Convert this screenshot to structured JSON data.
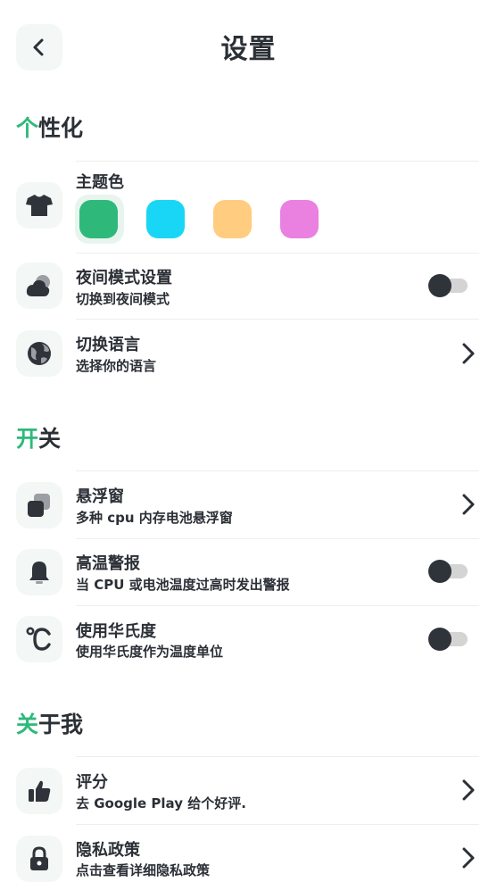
{
  "header": {
    "title": "设置"
  },
  "sections": {
    "personalize": {
      "accent": "个",
      "rest": "性化"
    },
    "switches": {
      "accent": "开",
      "rest": "关"
    },
    "about": {
      "accent": "关",
      "rest": "于我"
    }
  },
  "theme": {
    "label": "主题色",
    "selected_index": 0,
    "colors": [
      "#2eb97b",
      "#1ad6f6",
      "#ffcc80",
      "#ea80e0"
    ]
  },
  "night_mode": {
    "title": "夜间模式设置",
    "subtitle": "切换到夜间模式",
    "enabled": false
  },
  "language": {
    "title": "切换语言",
    "subtitle": "选择你的语言"
  },
  "floating": {
    "title": "悬浮窗",
    "subtitle": "多种 cpu 内存电池悬浮窗"
  },
  "temp_alert": {
    "title": "高温警报",
    "subtitle": "当 CPU 或电池温度过高时发出警报",
    "enabled": false
  },
  "fahrenheit": {
    "title": "使用华氏度",
    "subtitle": "使用华氏度作为温度单位",
    "enabled": false
  },
  "rating": {
    "title": "评分",
    "subtitle": "去 Google Play 给个好评."
  },
  "privacy": {
    "title": "隐私政策",
    "subtitle": "点击查看详细隐私政策"
  },
  "icons": {
    "back": "back-arrow-icon",
    "theme": "tshirt-icon",
    "night": "night-cloud-icon",
    "language": "globe-icon",
    "floating": "floating-window-icon",
    "alert": "bell-icon",
    "fahrenheit": "degree-icon",
    "rating": "thumbs-up-icon",
    "privacy": "lock-icon"
  }
}
